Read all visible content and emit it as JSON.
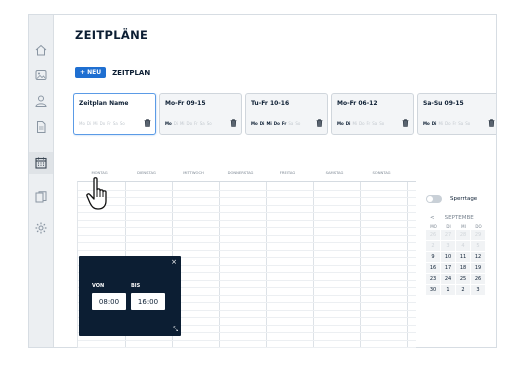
{
  "page": {
    "title": "ZEITPLÄNE"
  },
  "sidebar": {
    "items": [
      {
        "icon": "home-icon"
      },
      {
        "icon": "image-icon"
      },
      {
        "icon": "user-icon"
      },
      {
        "icon": "document-icon"
      },
      {
        "icon": "calendar-icon",
        "active": true
      },
      {
        "icon": "copy-icon"
      },
      {
        "icon": "gear-icon"
      }
    ]
  },
  "toolbar": {
    "new_button": "+ NEU",
    "new_label": "ZEITPLAN"
  },
  "schedules": [
    {
      "name": "Zeitplan Name",
      "selected": true,
      "days": [
        [
          "Mo",
          false
        ],
        [
          "Di",
          false
        ],
        [
          "Mi",
          false
        ],
        [
          "Do",
          false
        ],
        [
          "Fr",
          false
        ],
        [
          "Sa",
          false
        ],
        [
          "So",
          false
        ]
      ]
    },
    {
      "name": "Mo-Fr 09-15",
      "days": [
        [
          "Mo",
          true
        ],
        [
          "Di",
          false
        ],
        [
          "Mi",
          false
        ],
        [
          "Do",
          false
        ],
        [
          "Fr",
          false
        ],
        [
          "Sa",
          false
        ],
        [
          "So",
          false
        ]
      ]
    },
    {
      "name": "Tu-Fr 10-16",
      "days": [
        [
          "Mo",
          true
        ],
        [
          "Di",
          true
        ],
        [
          "Mi",
          true
        ],
        [
          "Do",
          true
        ],
        [
          "Fr",
          true
        ],
        [
          "Sa",
          false
        ],
        [
          "So",
          false
        ]
      ]
    },
    {
      "name": "Mo-Fr 06-12",
      "days": [
        [
          "Mo",
          true
        ],
        [
          "Di",
          true
        ],
        [
          "Mi",
          false
        ],
        [
          "Do",
          false
        ],
        [
          "Fr",
          false
        ],
        [
          "Sa",
          false
        ],
        [
          "So",
          false
        ]
      ]
    },
    {
      "name": "Sa-Su 09-15",
      "days": [
        [
          "Mo",
          true
        ],
        [
          "Di",
          true
        ],
        [
          "Mi",
          false
        ],
        [
          "Do",
          false
        ],
        [
          "Fr",
          false
        ],
        [
          "Sa",
          false
        ],
        [
          "So",
          false
        ]
      ]
    }
  ],
  "weekdays": [
    "MONTAG",
    "DIENSTAG",
    "MITTWOCH",
    "DONNERSTAG",
    "FREITAG",
    "SAMSTAG",
    "SONNTAG"
  ],
  "time_popup": {
    "from_label": "VON",
    "to_label": "BIS",
    "from_value": "08:00",
    "to_value": "16:00",
    "close_symbol": "×"
  },
  "lock_days": {
    "label": "Sperrtage",
    "enabled": false
  },
  "calendar": {
    "month": "SEPTEMBE",
    "prev": "<",
    "weekdays": [
      "MO",
      "DI",
      "MI",
      "DO"
    ],
    "rows": [
      [
        [
          "26",
          true
        ],
        [
          "27",
          true
        ],
        [
          "28",
          true
        ],
        [
          "29",
          true
        ]
      ],
      [
        [
          "2",
          true
        ],
        [
          "3",
          true
        ],
        [
          "4",
          true
        ],
        [
          "5",
          true
        ]
      ],
      [
        [
          "9",
          false
        ],
        [
          "10",
          false
        ],
        [
          "11",
          false
        ],
        [
          "12",
          false
        ]
      ],
      [
        [
          "16",
          false
        ],
        [
          "17",
          false
        ],
        [
          "18",
          false
        ],
        [
          "19",
          false
        ]
      ],
      [
        [
          "23",
          false
        ],
        [
          "24",
          false
        ],
        [
          "25",
          false
        ],
        [
          "26",
          false
        ]
      ],
      [
        [
          "30",
          false
        ],
        [
          "1",
          false
        ],
        [
          "2",
          false
        ],
        [
          "3",
          false
        ]
      ]
    ]
  },
  "colors": {
    "primary": "#1f6fd1",
    "navy": "#0c1e33",
    "selected_border": "#5b9be6"
  }
}
